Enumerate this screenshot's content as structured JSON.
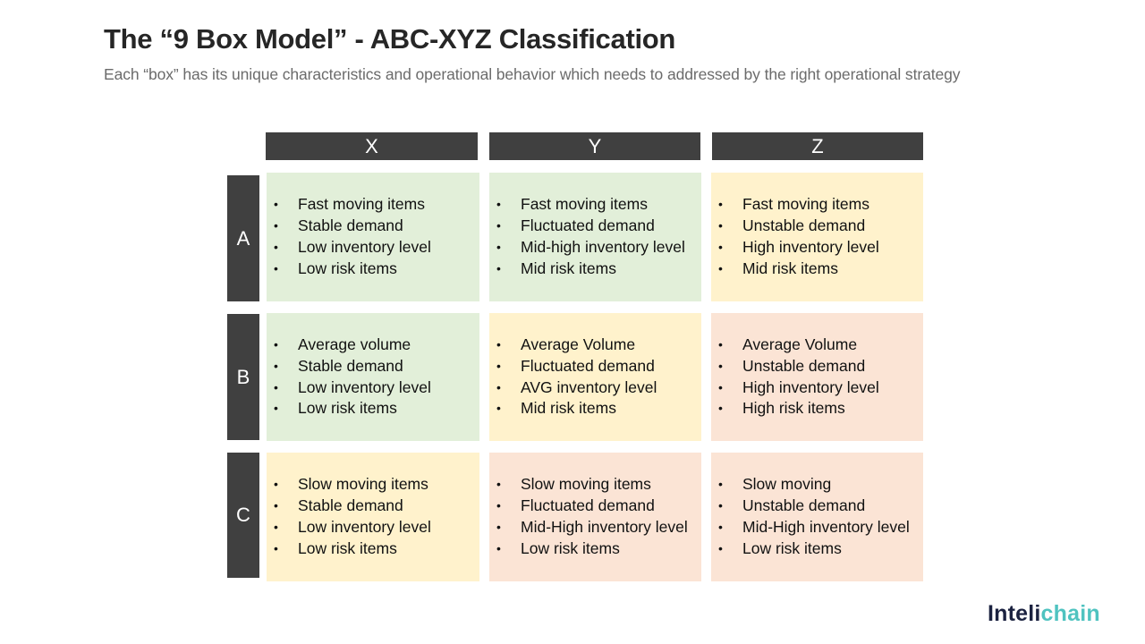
{
  "title": "The “9 Box Model” - ABC-XYZ Classification",
  "subtitle": "Each “box” has its unique characteristics and operational behavior which needs to addressed by the right operational strategy",
  "columns": [
    "X",
    "Y",
    "Z"
  ],
  "rows": [
    "A",
    "B",
    "C"
  ],
  "colors": {
    "header": "#404040",
    "green": "#e2efd9",
    "yellow": "#fff2cc",
    "salmon": "#fbe4d5"
  },
  "cells": {
    "A": {
      "X": {
        "color": "green",
        "items": [
          "Fast moving items",
          "Stable demand",
          "Low inventory level",
          "Low risk items"
        ]
      },
      "Y": {
        "color": "green",
        "items": [
          "Fast moving items",
          "Fluctuated demand",
          "Mid-high inventory level",
          "Mid risk items"
        ]
      },
      "Z": {
        "color": "yellow",
        "items": [
          "Fast moving items",
          "Unstable demand",
          "High inventory level",
          "Mid risk items"
        ]
      }
    },
    "B": {
      "X": {
        "color": "green",
        "items": [
          "Average volume",
          "Stable demand",
          "Low inventory level",
          "Low risk items"
        ]
      },
      "Y": {
        "color": "yellow",
        "items": [
          "Average Volume",
          "Fluctuated demand",
          "AVG inventory level",
          "Mid risk items"
        ]
      },
      "Z": {
        "color": "salmon",
        "items": [
          "Average Volume",
          "Unstable demand",
          "High inventory level",
          "High risk items"
        ]
      }
    },
    "C": {
      "X": {
        "color": "yellow",
        "items": [
          "Slow moving items",
          "Stable demand",
          "Low inventory level",
          "Low risk items"
        ]
      },
      "Y": {
        "color": "salmon",
        "items": [
          "Slow moving items",
          "Fluctuated demand",
          "Mid-High inventory level",
          "Low risk items"
        ]
      },
      "Z": {
        "color": "salmon",
        "items": [
          "Slow moving",
          "Unstable demand",
          "Mid-High inventory level",
          "Low risk items"
        ]
      }
    }
  },
  "bullet_glyph": "•",
  "logo": {
    "part1": "Inteli",
    "part2": "chain"
  }
}
